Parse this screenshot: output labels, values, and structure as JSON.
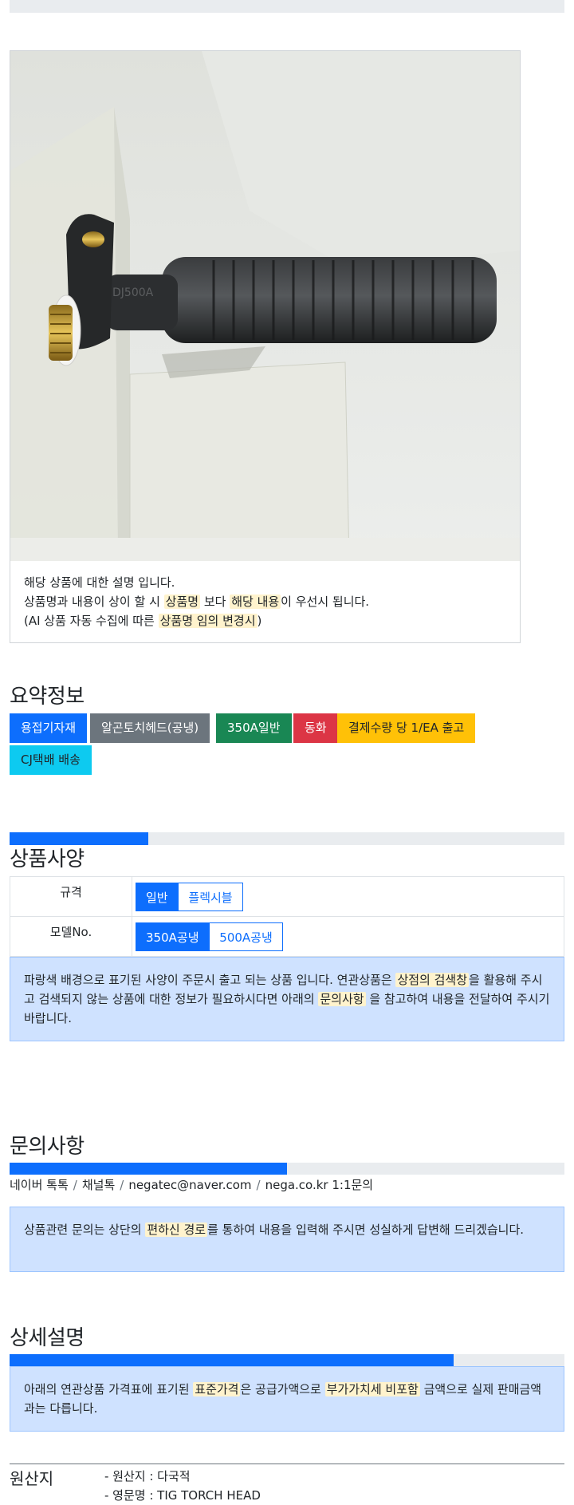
{
  "product_card": {
    "image_desc": "TIG torch head",
    "lines": {
      "l1": "해당 상품에 대한 설명 입니다.",
      "l2_a": "상품명과 내용이 상이 할 시 ",
      "l2_hl1": "상품명",
      "l2_b": " 보다 ",
      "l2_hl2": "해당 내용",
      "l2_c": "이 우선시 됩니다.",
      "l3_a": "(AI 상품 자동 수집에 따른 ",
      "l3_hl": "상품명 임의 변경시",
      "l3_b": ")"
    },
    "engraving": "DJ500A"
  },
  "summary": {
    "title": "요약정보",
    "badges": [
      "용접기자재",
      "알곤토치헤드(공냉)",
      "350A일반",
      "동화",
      "결제수량 당 1/EA 출고",
      "CJ택배 배송"
    ]
  },
  "colors": {
    "primary": "#0d6efd",
    "secondary": "#6c757d",
    "success": "#198754",
    "danger": "#dc3545",
    "warning": "#ffc107",
    "info": "#0dcaf0"
  },
  "spec": {
    "title": "상품사양",
    "progress_pct": 25,
    "rows": [
      {
        "label": "규격",
        "options": [
          "일반",
          "플렉시블"
        ],
        "selected": "일반"
      },
      {
        "label": "모델No.",
        "options": [
          "350A공냉",
          "500A공냉"
        ],
        "selected": "350A공냉"
      }
    ],
    "notice": {
      "a": "파랑색 배경으로 표기된 사양이 주문시 출고 되는 상품 입니다. 연관상품은 ",
      "hl1": "상점의 검색창",
      "b": "을 활용해 주시고 검색되지 않는 상품에 대한 정보가 필요하시다면 아래의 ",
      "hl2": "문의사항",
      "c": " 을 참고하여 내용을 전달하여 주시기 바랍니다."
    }
  },
  "inquiry": {
    "title": "문의사항",
    "progress_pct": 50,
    "contacts": [
      "네이버 톡톡",
      "채널톡",
      "negatec@naver.com",
      "nega.co.kr 1:1문의"
    ],
    "sep": "/",
    "notice": {
      "a": "상품관련 문의는 상단의 ",
      "hl": "편하신 경로",
      "b": "를 통하여 내용을 입력해 주시면 성실하게 답변해 드리겠습니다."
    }
  },
  "detail": {
    "title": "상세설명",
    "progress_pct": 80,
    "notice": {
      "a": "아래의 연관상품 가격표에 표기된 ",
      "hl1": "표준가격",
      "b": "은 공급가액으로 ",
      "hl2": "부가가치세 비포함",
      "c": " 금액으로 실제 판매금액과는 다릅니다."
    }
  },
  "origin": {
    "label": "원산지",
    "items": [
      "- 원산지 : 다국적",
      "- 영문명 : TIG TORCH HEAD"
    ]
  }
}
